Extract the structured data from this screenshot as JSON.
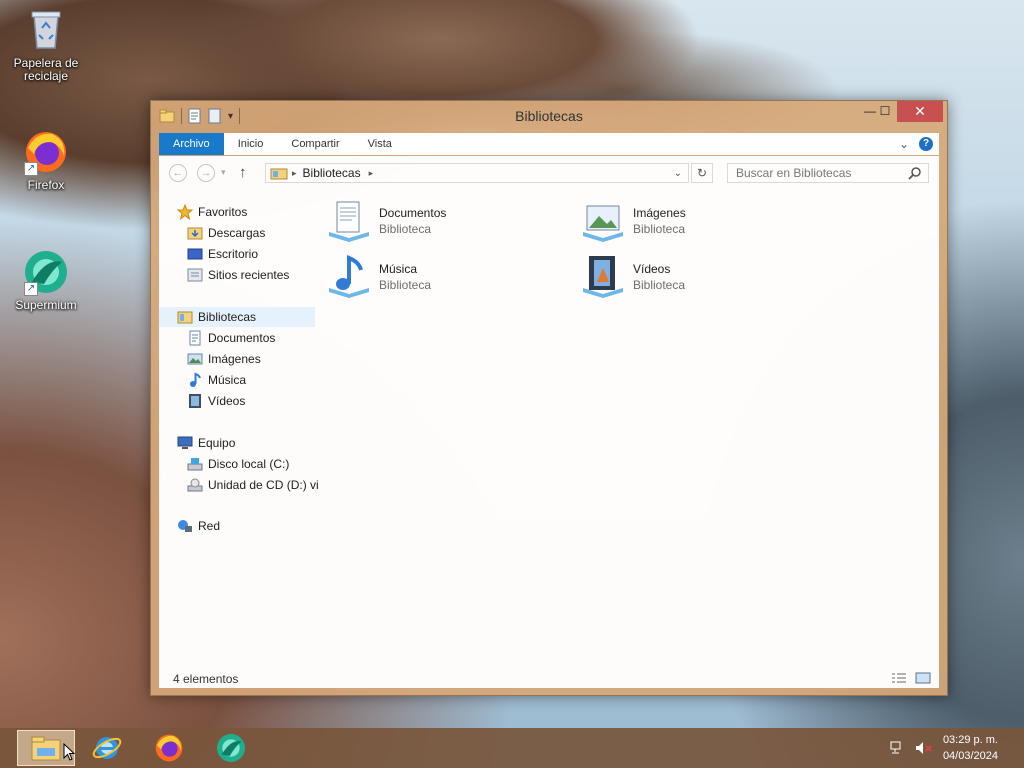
{
  "desktop": {
    "icons": [
      {
        "label": "Papelera de reciclaje",
        "icon": "recycle-bin-icon"
      },
      {
        "label": "Firefox",
        "icon": "firefox-icon"
      },
      {
        "label": "Supermium",
        "icon": "supermium-icon"
      }
    ]
  },
  "window": {
    "title": "Bibliotecas",
    "controls": {
      "minimize": "—",
      "maximize": "☐",
      "close": "✕"
    },
    "ribbon": {
      "tabs": [
        "Archivo",
        "Inicio",
        "Compartir",
        "Vista"
      ],
      "expand_glyph": "⌄",
      "help_glyph": "?"
    },
    "navigation": {
      "back": "←",
      "forward": "→",
      "up": "↑",
      "address_segment": "Bibliotecas",
      "address_arrow": "▸",
      "refresh": "↻"
    },
    "search": {
      "placeholder": "Buscar en Bibliotecas",
      "icon": "search-icon"
    },
    "nav_pane": {
      "favorites": {
        "label": "Favoritos",
        "items": [
          "Descargas",
          "Escritorio",
          "Sitios recientes"
        ]
      },
      "libraries": {
        "label": "Bibliotecas",
        "items": [
          "Documentos",
          "Imágenes",
          "Música",
          "Vídeos"
        ]
      },
      "computer": {
        "label": "Equipo",
        "items": [
          "Disco local (C:)",
          "Unidad de CD (D:) vi"
        ]
      },
      "network": {
        "label": "Red"
      }
    },
    "content": {
      "items": [
        {
          "name": "Documentos",
          "type": "Biblioteca",
          "icon": "documents-library-icon"
        },
        {
          "name": "Imágenes",
          "type": "Biblioteca",
          "icon": "pictures-library-icon"
        },
        {
          "name": "Música",
          "type": "Biblioteca",
          "icon": "music-library-icon"
        },
        {
          "name": "Vídeos",
          "type": "Biblioteca",
          "icon": "videos-library-icon"
        }
      ]
    },
    "status": {
      "item_count": "4 elementos"
    }
  },
  "taskbar": {
    "apps": [
      "file-explorer-icon",
      "internet-explorer-icon",
      "firefox-icon",
      "supermium-icon"
    ],
    "tray": {
      "network": "network-icon",
      "volume": "volume-muted-icon"
    },
    "clock": {
      "time": "03:29 p. m.",
      "date": "04/03/2024"
    }
  },
  "colors": {
    "accent": "#1979ca",
    "window_frame": "#d6a878",
    "close": "#c75050"
  }
}
